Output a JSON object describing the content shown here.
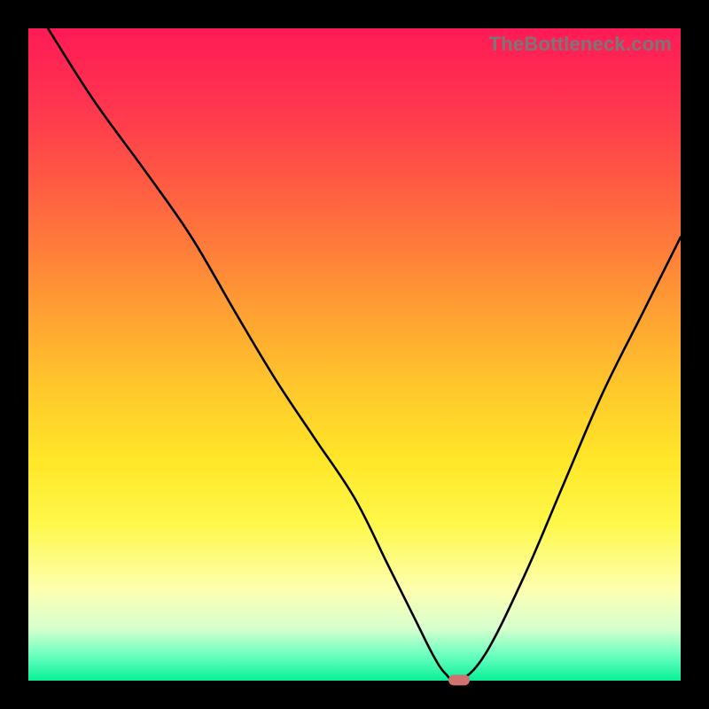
{
  "watermark": "TheBottleneck.com",
  "colors": {
    "frame": "#000000",
    "curve": "#000000",
    "marker": "#d17272"
  },
  "chart_data": {
    "type": "line",
    "title": "",
    "xlabel": "",
    "ylabel": "",
    "xlim": [
      0,
      100
    ],
    "ylim": [
      0,
      100
    ],
    "grid": false,
    "legend": false,
    "x": [
      3,
      10,
      18,
      25,
      32,
      38,
      44,
      50,
      55,
      59,
      62,
      64,
      66,
      70,
      76,
      82,
      88,
      94,
      100
    ],
    "values": [
      100,
      89,
      78,
      68,
      56,
      46,
      37,
      28,
      18,
      10,
      4,
      1,
      0,
      4,
      16,
      30,
      44,
      56,
      68
    ],
    "marker": {
      "x": 66,
      "y": 0
    }
  }
}
